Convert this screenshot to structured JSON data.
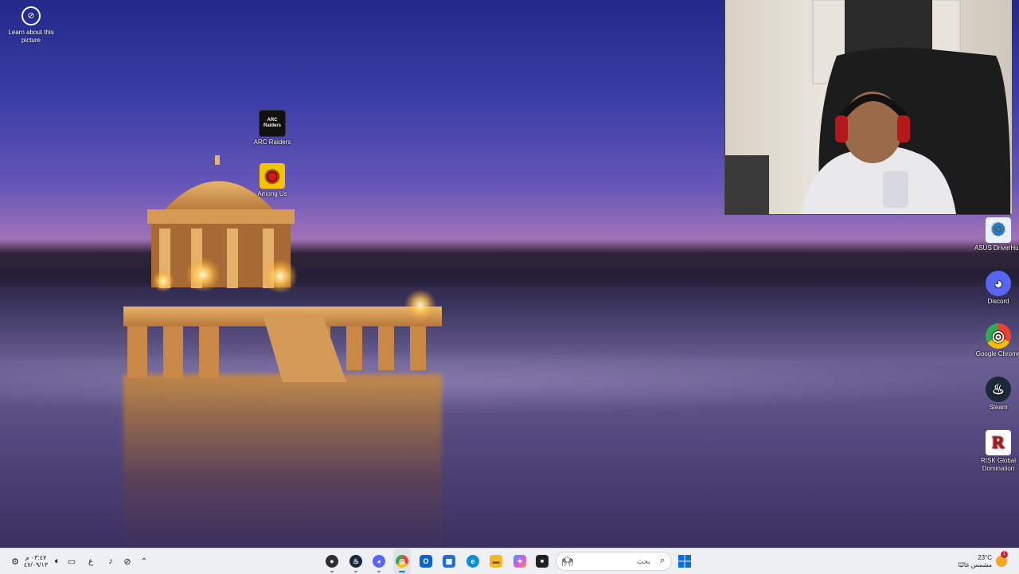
{
  "desktop": {
    "learn_label": "Learn about this picture",
    "icons": [
      {
        "label": "ARC Raiders",
        "glyph": "ARC Raiders",
        "color": "#111111"
      },
      {
        "label": "Among Us",
        "glyph": "◉",
        "color": "#f2c500"
      },
      {
        "label": "ASUS DriverHub",
        "glyph": "⚙",
        "color": "#1e88e5"
      },
      {
        "label": "Discord",
        "glyph": "◕",
        "color": "#5865f2"
      },
      {
        "label": "Google Chrome",
        "glyph": "◎",
        "color": "#ffffff"
      },
      {
        "label": "Steam",
        "glyph": "♨",
        "color": "#1b2838"
      },
      {
        "label": "RISK Global Domination",
        "glyph": "R",
        "color": "#ffffff"
      }
    ]
  },
  "taskbar": {
    "clock_time": "٠٣:٤٧ م",
    "clock_date": "٤٧/٠٩/١٣",
    "lang": "ع",
    "search_placeholder": "بحث",
    "weather_temp": "23°C",
    "weather_desc": "مشمس غالبًا",
    "weather_badge": "1",
    "apps": [
      {
        "name": "obs",
        "glyph": "●",
        "color": "#302e31"
      },
      {
        "name": "steam",
        "glyph": "♨",
        "color": "#1b2838"
      },
      {
        "name": "discord",
        "glyph": "◕",
        "color": "#5865f2"
      },
      {
        "name": "chrome",
        "glyph": "◎",
        "color": "#ea4335"
      },
      {
        "name": "outlook",
        "glyph": "O",
        "color": "#0a64c8"
      },
      {
        "name": "store",
        "glyph": "▦",
        "color": "#1d6fd6"
      },
      {
        "name": "edge",
        "glyph": "e",
        "color": "#0f8fd3"
      },
      {
        "name": "explorer",
        "glyph": "▬",
        "color": "#f1b72e"
      },
      {
        "name": "copilot",
        "glyph": "✦",
        "color": "#7a5cf5"
      },
      {
        "name": "terminal",
        "glyph": "■",
        "color": "#202020"
      }
    ]
  }
}
